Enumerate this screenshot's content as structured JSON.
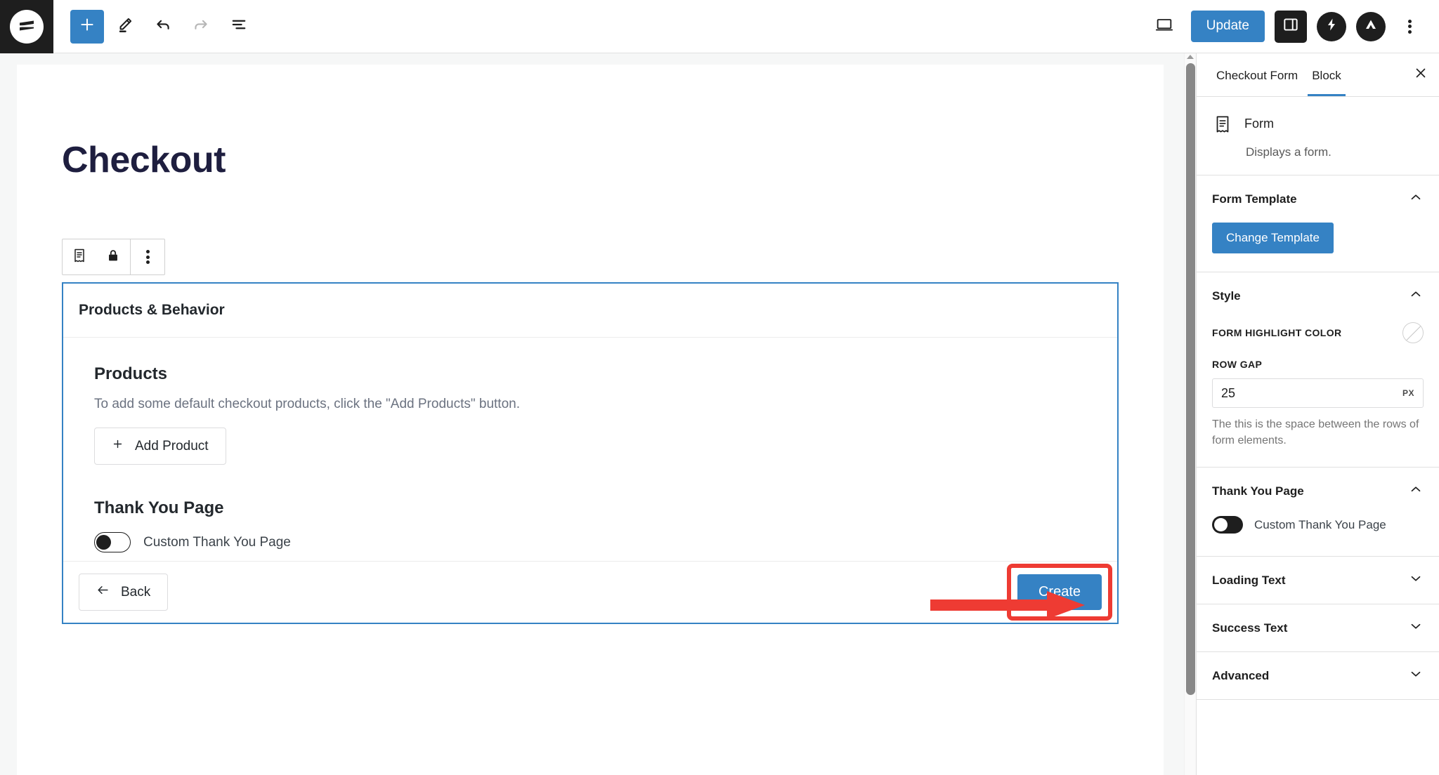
{
  "topbar": {
    "logo_icon": "site-logo-icon",
    "tools": [
      {
        "name": "add-block-button",
        "icon": "plus-icon",
        "label": "+"
      },
      {
        "name": "edit-tools-button",
        "icon": "pencil-icon",
        "label": ""
      },
      {
        "name": "undo-button",
        "icon": "undo-arrow-icon",
        "label": ""
      },
      {
        "name": "redo-button",
        "icon": "redo-arrow-icon",
        "label": ""
      },
      {
        "name": "list-view-button",
        "icon": "list-view-icon",
        "label": ""
      }
    ],
    "preview_icon": "desktop-preview-icon",
    "update_label": "Update",
    "settings_icon": "sidebar-panel-icon",
    "plugin_icon": "lightning-bolt-icon",
    "brand_icon": "triangle-brand-icon",
    "options_icon": "vertical-ellipsis-icon"
  },
  "editor": {
    "post_title": "Checkout",
    "block_toolbar": [
      {
        "name": "form-block-icon",
        "icon": "form-receipt-icon"
      },
      {
        "name": "lock-icon",
        "icon": "lock-icon"
      },
      {
        "name": "block-options-button",
        "icon": "vertical-ellipsis-icon"
      }
    ],
    "form_block": {
      "header_title": "Products & Behavior",
      "products": {
        "heading": "Products",
        "description": "To add some default checkout products, click the \"Add Products\" button.",
        "add_button_label": "Add Product",
        "add_button_icon": "plus-icon"
      },
      "thank_you": {
        "heading": "Thank You Page",
        "toggle_label": "Custom Thank You Page",
        "toggle_state": "off"
      },
      "footer": {
        "back_label": "Back",
        "back_icon": "arrow-left-icon",
        "create_label": "Create"
      }
    },
    "annotation": {
      "arrow_color": "#ee3b33",
      "highlight_color": "#ee3b33",
      "target": "Create"
    }
  },
  "sidebar": {
    "tabs": [
      {
        "label": "Checkout Form",
        "active": false
      },
      {
        "label": "Block",
        "active": true
      }
    ],
    "close_icon": "close-icon",
    "block_card": {
      "icon": "form-receipt-icon",
      "name": "Form",
      "description": "Displays a form."
    },
    "panels": [
      {
        "title": "Form Template",
        "expanded": true,
        "change_template_label": "Change Template"
      },
      {
        "title": "Style",
        "expanded": true,
        "color_label": "FORM HIGHLIGHT COLOR",
        "color_value": "",
        "row_gap_label": "ROW GAP",
        "row_gap_value": "25",
        "row_gap_unit": "PX",
        "row_gap_help": "The this is the space between the rows of form elements."
      },
      {
        "title": "Thank You Page",
        "expanded": true,
        "toggle_label": "Custom Thank You Page",
        "toggle_state": "off"
      },
      {
        "title": "Loading Text",
        "expanded": false
      },
      {
        "title": "Success Text",
        "expanded": false
      },
      {
        "title": "Advanced",
        "expanded": false
      }
    ]
  },
  "colors": {
    "accent_blue": "#3582c4",
    "dark": "#1e1e1e",
    "annotation_red": "#ee3b33",
    "canvas_bg": "#f6f7f7"
  }
}
